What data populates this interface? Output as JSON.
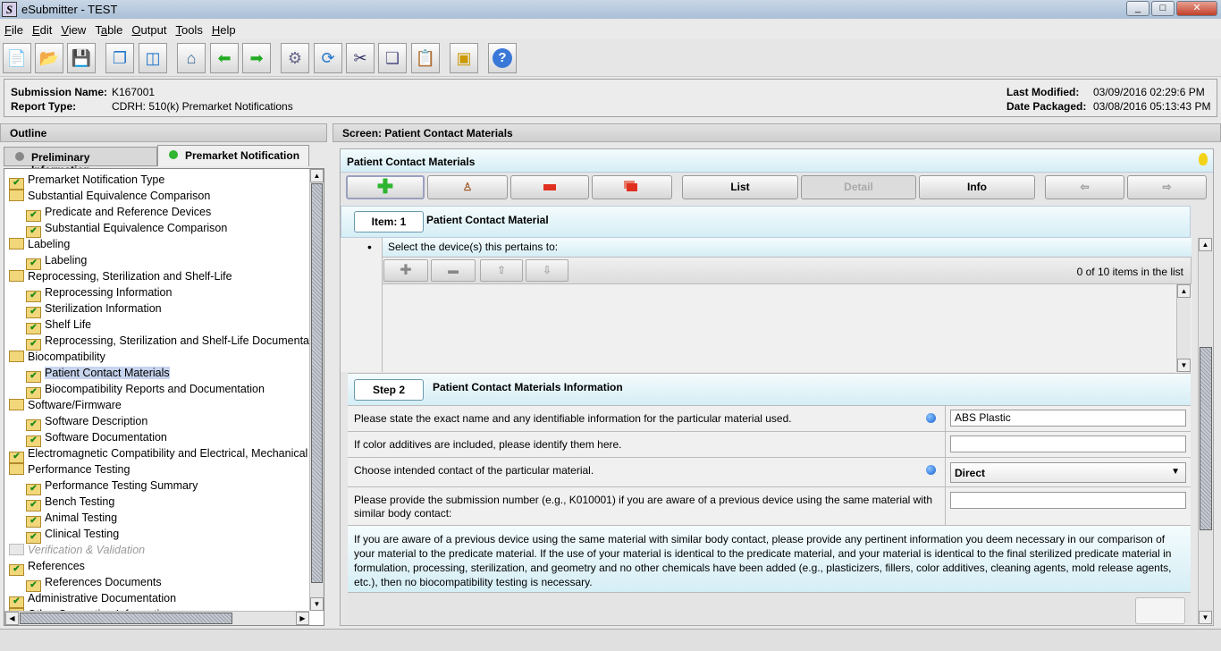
{
  "window": {
    "title": "eSubmitter - TEST",
    "logo": "S"
  },
  "menu": [
    "File",
    "Edit",
    "View",
    "Table",
    "Output",
    "Tools",
    "Help"
  ],
  "toolbar": [
    "new-file-icon",
    "open-folder-icon",
    "save-icon",
    "cascade-windows-icon",
    "split-view-icon",
    "home-icon",
    "back-icon",
    "forward-icon",
    "settings-run-icon",
    "refresh-icon",
    "cut-icon",
    "copy-icon",
    "paste-icon",
    "package-icon",
    "help-icon"
  ],
  "info": {
    "submission_label": "Submission Name:",
    "submission_value": "K167001",
    "report_label": "Report Type:",
    "report_value": "CDRH: 510(k) Premarket Notifications",
    "modified_label": "Last Modified:",
    "modified_value": "03/09/2016 02:29:6 PM",
    "packaged_label": "Date Packaged:",
    "packaged_value": "03/08/2016 05:13:43 PM"
  },
  "outline": {
    "title": "Outline",
    "tabs": [
      "Preliminary Information",
      "Premarket Notification"
    ],
    "tree": [
      {
        "label": "Premarket Notification Type",
        "level": 0,
        "check": true
      },
      {
        "label": "Substantial Equivalence Comparison",
        "level": 0,
        "check": false
      },
      {
        "label": "Predicate and Reference Devices",
        "level": 1,
        "check": true
      },
      {
        "label": "Substantial Equivalence Comparison",
        "level": 1,
        "check": true
      },
      {
        "label": "Labeling",
        "level": 0,
        "check": false
      },
      {
        "label": "Labeling",
        "level": 1,
        "check": true
      },
      {
        "label": "Reprocessing, Sterilization and Shelf-Life",
        "level": 0,
        "check": false
      },
      {
        "label": "Reprocessing Information",
        "level": 1,
        "check": true
      },
      {
        "label": "Sterilization Information",
        "level": 1,
        "check": true
      },
      {
        "label": "Shelf Life",
        "level": 1,
        "check": true
      },
      {
        "label": "Reprocessing, Sterilization and Shelf-Life Documentation",
        "level": 1,
        "check": true
      },
      {
        "label": "Biocompatibility",
        "level": 0,
        "check": false
      },
      {
        "label": "Patient Contact Materials",
        "level": 1,
        "check": true,
        "selected": true
      },
      {
        "label": "Biocompatibility Reports and Documentation",
        "level": 1,
        "check": true
      },
      {
        "label": "Software/Firmware",
        "level": 0,
        "check": false
      },
      {
        "label": "Software Description",
        "level": 1,
        "check": true
      },
      {
        "label": "Software Documentation",
        "level": 1,
        "check": true
      },
      {
        "label": "Electromagnetic Compatibility and Electrical, Mechanical and Thermal Safety",
        "level": 0,
        "check": true
      },
      {
        "label": "Performance Testing",
        "level": 0,
        "check": false
      },
      {
        "label": "Performance Testing Summary",
        "level": 1,
        "check": true
      },
      {
        "label": "Bench Testing",
        "level": 1,
        "check": true
      },
      {
        "label": "Animal Testing",
        "level": 1,
        "check": true
      },
      {
        "label": "Clinical Testing",
        "level": 1,
        "check": true
      },
      {
        "label": "Verification & Validation",
        "level": 0,
        "check": false,
        "disabled": true
      },
      {
        "label": "References",
        "level": 0,
        "check": true
      },
      {
        "label": "References Documents",
        "level": 1,
        "check": true
      },
      {
        "label": "Administrative Documentation",
        "level": 0,
        "check": true
      },
      {
        "label": "Other Supporting Information",
        "level": 0,
        "check": false
      }
    ]
  },
  "screen": {
    "title": "Screen: Patient Contact Materials",
    "panel_title": "Patient Contact Materials",
    "buttons": {
      "list": "List",
      "detail": "Detail",
      "info": "Info"
    },
    "item_label": "Item: 1",
    "item_title": "Patient Contact Material",
    "select_prompt": "Select the device(s) this pertains to:",
    "list_count": "0 of 10 items in the list",
    "step_label": "Step 2",
    "step_title": "Patient Contact Materials Information",
    "q1": "Please state the exact name and any identifiable information for the particular material used.",
    "a1": "ABS Plastic",
    "q2": "If color additives are included, please identify them here.",
    "a2": "",
    "q3": "Choose intended contact of the particular material.",
    "a3": "Direct",
    "q4": "Please provide the submission number (e.g., K010001) if you are aware of a previous device using the same material with similar body contact:",
    "a4": "",
    "note": "If you are aware of a previous device using the same material with similar body contact, please provide any pertinent information you deem necessary in our comparison of your material to the predicate material.  If the use of your material is identical to the predicate material, and your material is identical to the final sterilized predicate material in formulation, processing, sterilization, and geometry and no other chemicals have been added (e.g., plasticizers, fillers, color additives, cleaning agents, mold release agents, etc.), then no biocompatibility testing is necessary."
  }
}
